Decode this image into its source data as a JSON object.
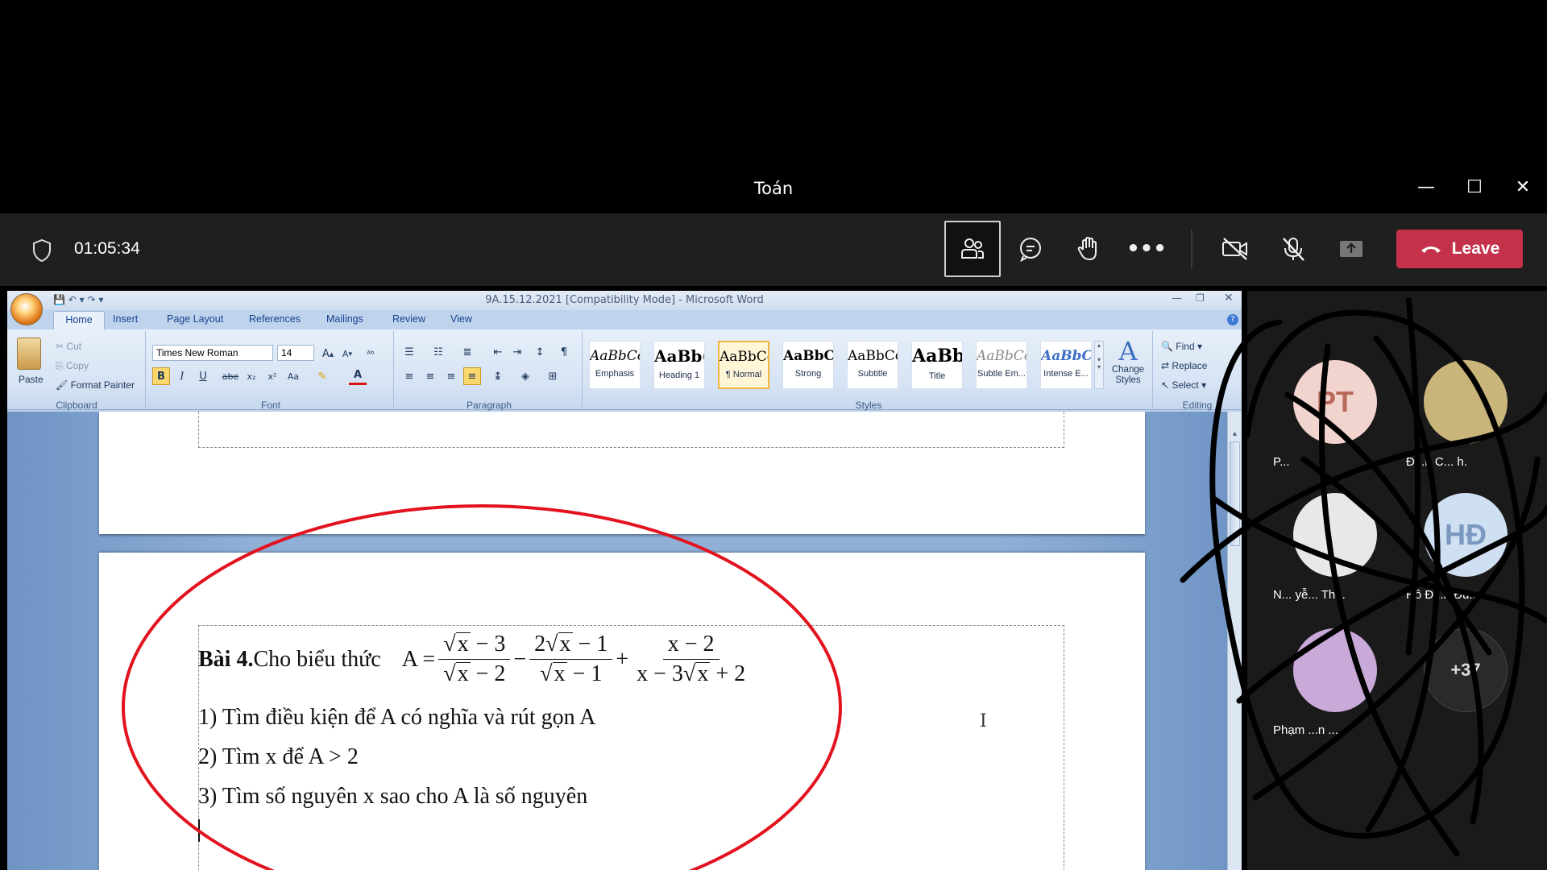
{
  "window": {
    "title": "Toán",
    "minimize": "—",
    "maximize": "☐",
    "close": "✕"
  },
  "meeting": {
    "timer": "01:05:34",
    "leave_label": "Leave"
  },
  "word": {
    "title": "9A.15.12.2021 [Compatibility Mode] - Microsoft Word",
    "tabs": [
      "Home",
      "Insert",
      "Page Layout",
      "References",
      "Mailings",
      "Review",
      "View"
    ],
    "clipboard": {
      "paste": "Paste",
      "cut": "Cut",
      "copy": "Copy",
      "format_painter": "Format Painter",
      "group": "Clipboard"
    },
    "font": {
      "name": "Times New Roman",
      "size": "14",
      "group": "Font"
    },
    "paragraph": {
      "group": "Paragraph"
    },
    "styles": {
      "group": "Styles",
      "items": [
        {
          "sample": "AaBbCcı",
          "name": "Emphasis"
        },
        {
          "sample": "AaBb(",
          "name": "Heading 1"
        },
        {
          "sample": "AaBbCcI",
          "name": "¶ Normal"
        },
        {
          "sample": "AaBbCc",
          "name": "Strong"
        },
        {
          "sample": "AaBbCcI",
          "name": "Subtitle"
        },
        {
          "sample": "AaBb(",
          "name": "Title"
        },
        {
          "sample": "AaBbCcı",
          "name": "Subtle Em..."
        },
        {
          "sample": "AaBbCc",
          "name": "Intense E..."
        }
      ],
      "change_styles": "Change Styles"
    },
    "editing": {
      "find": "Find",
      "replace": "Replace",
      "select": "Select",
      "group": "Editing"
    }
  },
  "document": {
    "bai_label": "Bài 4.",
    "bai_text": " Cho biểu thức",
    "expr_lhs": "A =",
    "q1": "1) Tìm điều kiện để A có nghĩa và rút gọn A",
    "q2": "2) Tìm x để A > 2",
    "q3": "3) Tìm số nguyên x sao cho A là số nguyên"
  },
  "participants": [
    {
      "initials": "PT",
      "name": "P...",
      "color": "#f2d4ce"
    },
    {
      "initials": "",
      "name": "Đ...n C... h.",
      "color": "#c9b57a"
    },
    {
      "initials": "",
      "name": "N... yễ... Th...",
      "color": "#e8e8e8"
    },
    {
      "initials": "HĐ",
      "name": "Hồ Đ...n Đu...",
      "color": "#cfe0f3"
    },
    {
      "initials": "",
      "name": "Phạm ...n ...",
      "color": "#c8a9d8"
    },
    {
      "initials": "+37",
      "name": "",
      "color": "#2a2a2a"
    }
  ]
}
